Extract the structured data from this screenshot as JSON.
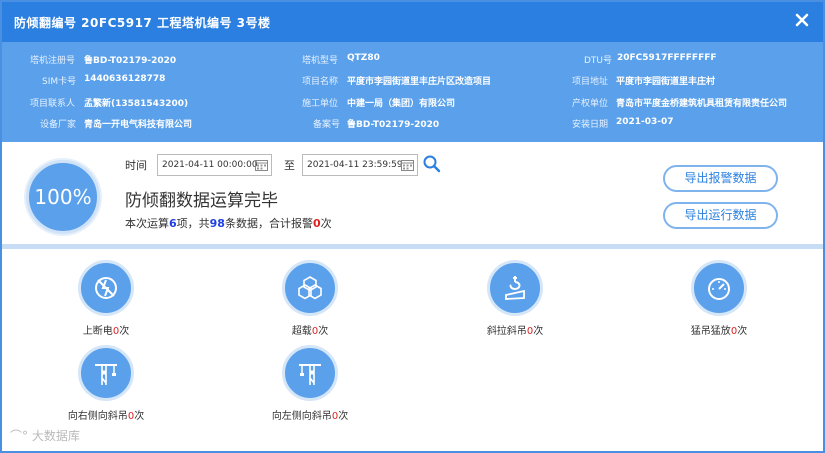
{
  "window": {
    "title": "防倾翻编号 20FC5917  工程塔机编号 3号楼"
  },
  "info": {
    "row1": {
      "reg_label": "塔机注册号",
      "reg_value": "鲁BD-T02179-2020",
      "model_label": "塔机型号",
      "model_value": "QTZ80",
      "dtu_label": "DTU号",
      "dtu_value": "20FC5917FFFFFFFF"
    },
    "row2": {
      "sim_label": "SIM卡号",
      "sim_value": "1440636128778",
      "project_label": "项目名称",
      "project_value": "平度市李园街道里丰庄片区改造项目",
      "address_label": "项目地址",
      "address_value": "平度市李园街道里丰庄村"
    },
    "row3": {
      "contact_label": "项目联系人",
      "contact_value": "孟繁新(13581543200)",
      "builder_label": "施工单位",
      "builder_value": "中建一局（集团）有限公司",
      "owner_label": "产权单位",
      "owner_value": "青岛市平度金桥建筑机具租赁有限责任公司"
    },
    "row4": {
      "maker_label": "设备厂家",
      "maker_value": "青岛一开电气科技有限公司",
      "record_label": "备案号",
      "record_value": "鲁BD-T02179-2020",
      "install_label": "安装日期",
      "install_value": "2021-03-07"
    }
  },
  "summary": {
    "progress_text": "100%",
    "time_label": "时间",
    "start_time": "2021-04-11 00:00:00",
    "to_label": "至",
    "end_time": "2021-04-11 23:59:59",
    "done_text": "防倾翻数据运算完毕",
    "stat_prefix": "本次运算",
    "items_count": "6",
    "stat_mid1": "项，共",
    "data_count": "98",
    "stat_mid2": "条数据，合计报警",
    "alarm_count": "0",
    "stat_suffix": "次",
    "export_alarm_label": "导出报警数据",
    "export_run_label": "导出运行数据"
  },
  "items": [
    {
      "name": "上断电",
      "count": "0",
      "unit": "次",
      "icon": "power-off-icon"
    },
    {
      "name": "超载",
      "count": "0",
      "unit": "次",
      "icon": "overload-icon"
    },
    {
      "name": "斜拉斜吊",
      "count": "0",
      "unit": "次",
      "icon": "hook-icon"
    },
    {
      "name": "猛吊猛放",
      "count": "0",
      "unit": "次",
      "icon": "gauge-icon"
    },
    {
      "name": "向右侧向斜吊",
      "count": "0",
      "unit": "次",
      "icon": "crane-right-icon"
    },
    {
      "name": "向左侧向斜吊",
      "count": "0",
      "unit": "次",
      "icon": "crane-left-icon"
    }
  ],
  "watermark": "大数据库",
  "colors": {
    "title_bar": "#2a7fe0",
    "info_bg": "#5aa0ea",
    "accent": "#2a7fe0",
    "alarm": "#e02020",
    "count": "#1e40e6"
  }
}
